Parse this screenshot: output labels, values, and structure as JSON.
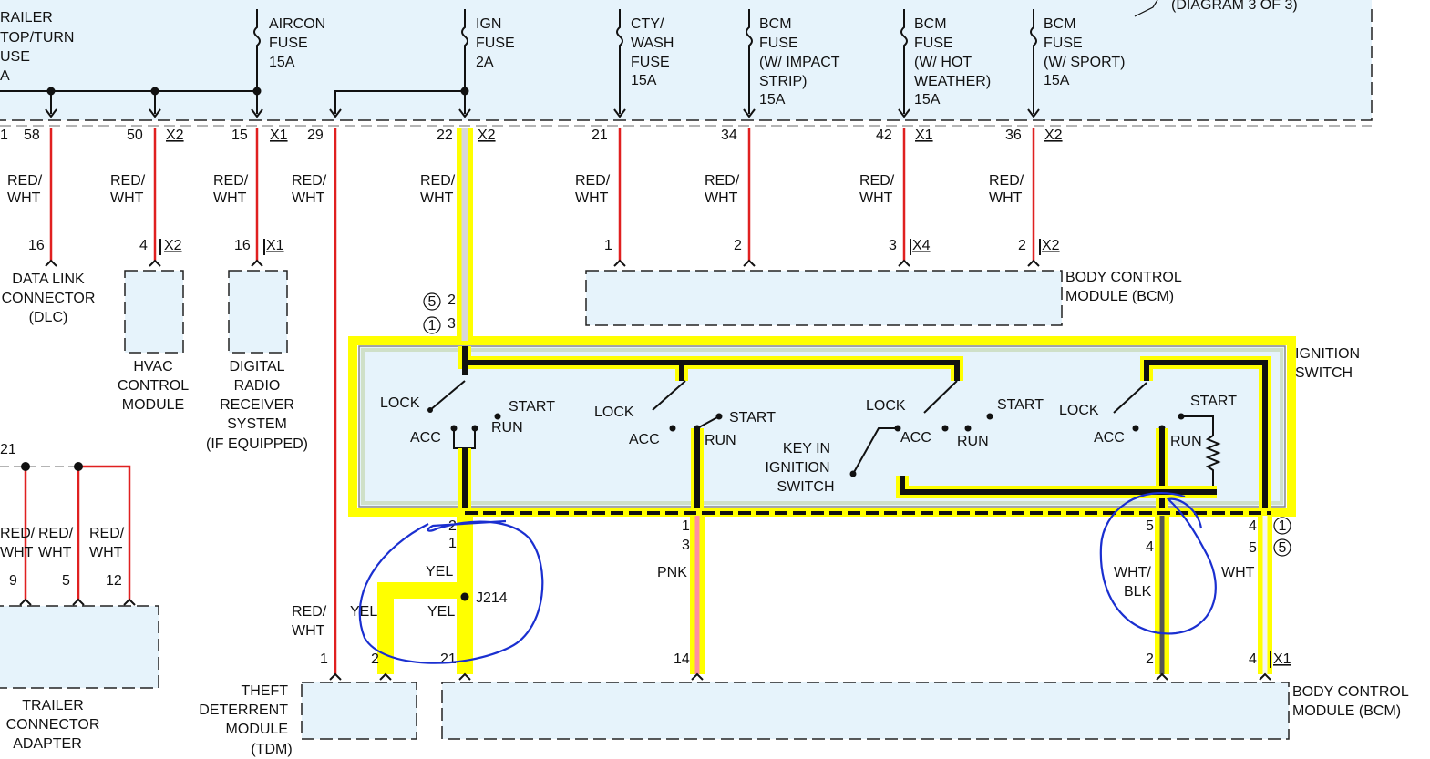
{
  "top_fuses": [
    {
      "id": "trailer",
      "lines": [
        "RAILER",
        "TOP/TURN",
        "USE",
        "A"
      ]
    },
    {
      "id": "aircon",
      "lines": [
        "AIRCON",
        "FUSE",
        "15A"
      ]
    },
    {
      "id": "ign",
      "lines": [
        "IGN",
        "FUSE",
        "2A"
      ]
    },
    {
      "id": "cty",
      "lines": [
        "CTY/",
        "WASH",
        "FUSE",
        "15A"
      ]
    },
    {
      "id": "bcm_impact",
      "lines": [
        "BCM",
        "FUSE",
        "(W/ IMPACT",
        "STRIP)",
        "15A"
      ]
    },
    {
      "id": "bcm_hot",
      "lines": [
        "BCM",
        "FUSE",
        "(W/ HOT",
        "WEATHER)",
        "15A"
      ]
    },
    {
      "id": "bcm_sport",
      "lines": [
        "BCM",
        "FUSE",
        "(W/ SPORT)",
        "15A"
      ]
    }
  ],
  "diagram_ref": "(DIAGRAM 3 OF 3)",
  "top_pins": {
    "p1": "1",
    "p58": "58",
    "p50": "50",
    "x2a": "X2",
    "p15": "15",
    "x1a": "X1",
    "p29": "29",
    "p22": "22",
    "x2b": "X2",
    "p21": "21",
    "p34": "34",
    "p42": "42",
    "x1b": "X1",
    "p36": "36",
    "x2c": "X2"
  },
  "wire_color": "RED/\nWHT",
  "wire_labels": {
    "red": "RED/",
    "wht": "WHT"
  },
  "lower_pins": {
    "p16a": "16",
    "p4": "4",
    "x2d": "X2",
    "p16b": "16",
    "x1c": "X1",
    "p1b": "1",
    "p2a": "2",
    "p3": "3",
    "x4": "X4",
    "p2b": "2",
    "x2e": "X2"
  },
  "modules": {
    "dlc": [
      "DATA LINK",
      "CONNECTOR",
      "(DLC)"
    ],
    "hvac": [
      "HVAC",
      "CONTROL",
      "MODULE"
    ],
    "radio": [
      "DIGITAL",
      "RADIO",
      "RECEIVER",
      "SYSTEM",
      "(IF EQUIPPED)"
    ],
    "bcm_top": [
      "BODY CONTROL",
      "MODULE (BCM)"
    ],
    "ign_switch": [
      "IGNITION",
      "SWITCH"
    ],
    "trailer": [
      "TRAILER",
      "CONNECTOR",
      "ADAPTER"
    ],
    "tdm": [
      "THEFT",
      "DETERRENT",
      "MODULE",
      "(TDM)"
    ],
    "bcm_bottom": [
      "BODY CONTROL",
      "MODULE (BCM)"
    ]
  },
  "switch_labels": {
    "lock": "LOCK",
    "start": "START",
    "acc": "ACC",
    "run": "RUN",
    "key_in": [
      "KEY IN",
      "IGNITION",
      "SWITCH"
    ]
  },
  "circle_refs": {
    "c5": "5",
    "c1": "1",
    "c1b": "1",
    "c5b": "5"
  },
  "switch_pins": {
    "p2": "2",
    "p3": "3",
    "b2": "2",
    "b1": "1",
    "b1b": "1",
    "b3": "3",
    "b5": "5",
    "b4": "4",
    "b4b": "4",
    "b5b": "5"
  },
  "bottom_wires": {
    "yel": "YEL",
    "pnk": "PNK",
    "whtblk": [
      "WHT/",
      "BLK"
    ],
    "wht": "WHT",
    "red": "RED/",
    "redw": "WHT"
  },
  "bottom_pins": {
    "p1": "1",
    "p2": "2",
    "p21": "21",
    "p14": "14",
    "p2b": "2",
    "p4": "4",
    "x1": "X1"
  },
  "splice": "J214",
  "trailer_pins": {
    "p21": "21",
    "p9": "9",
    "p5": "5",
    "p12": "12"
  },
  "colors": {
    "highlight": "#ffff00",
    "wire_red": "#e02020",
    "box_fill": "#e6f3fb",
    "annotation": "#1a2fd0",
    "pink": "#ff8fa0"
  }
}
